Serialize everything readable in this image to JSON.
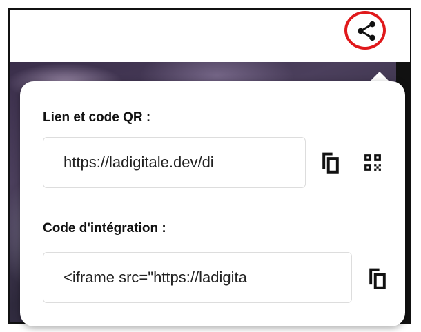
{
  "share": {
    "icon": "share-icon",
    "highlight_color": "#e0191b"
  },
  "link_section": {
    "label": "Lien et code QR :",
    "url_value": "https://ladigitale.dev/di",
    "copy_icon": "copy-icon",
    "qr_icon": "qr-code-icon"
  },
  "embed_section": {
    "label": "Code d'intégration :",
    "code_value": "<iframe src=\"https://ladigita",
    "copy_icon": "copy-icon"
  }
}
